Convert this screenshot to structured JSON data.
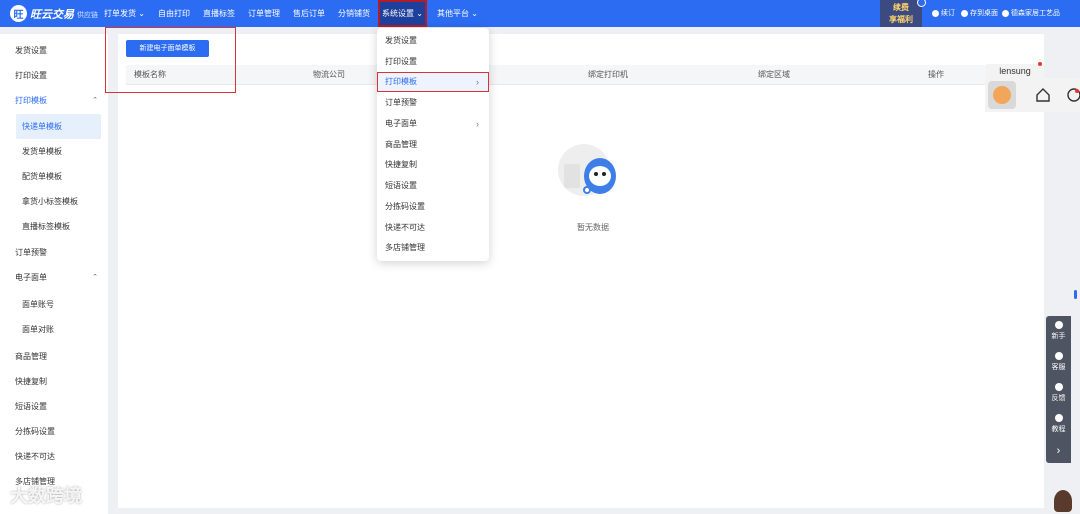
{
  "app": {
    "logo_mark": "旺",
    "logo_text": "旺云交易",
    "logo_sub": "供应链"
  },
  "topnav": [
    {
      "label": "打单发货 ⌄"
    },
    {
      "label": "自由打印"
    },
    {
      "label": "直播标签"
    },
    {
      "label": "订单管理"
    },
    {
      "label": "售后订单"
    },
    {
      "label": "分销铺货"
    },
    {
      "label": "系统设置 ⌄"
    },
    {
      "label": "其他平台 ⌄"
    }
  ],
  "vip": {
    "line1": "续费",
    "line2": "享福利"
  },
  "top_right": {
    "item1": "续订",
    "item2": "存到桌面",
    "item3": "德森家居工艺品"
  },
  "sidebar": {
    "items": [
      {
        "label": "发货设置"
      },
      {
        "label": "打印设置"
      },
      {
        "label": "打印模板",
        "chevron": "⌃"
      },
      {
        "label": "快递单模板"
      },
      {
        "label": "发货单模板"
      },
      {
        "label": "配货单模板"
      },
      {
        "label": "拿货小标签模板"
      },
      {
        "label": "直播标签模板"
      },
      {
        "label": "订单预警"
      },
      {
        "label": "电子面单",
        "chevron": "⌃"
      },
      {
        "label": "面单账号"
      },
      {
        "label": "面单对账"
      },
      {
        "label": "商品管理"
      },
      {
        "label": "快捷复制"
      },
      {
        "label": "短语设置"
      },
      {
        "label": "分拣码设置"
      },
      {
        "label": "快递不可达"
      },
      {
        "label": "多店铺管理"
      }
    ]
  },
  "main": {
    "new_button": "新建电子面单模板",
    "columns": [
      "模板名称",
      "物流公司",
      "",
      "绑定打印机",
      "绑定区域",
      "操作"
    ],
    "empty_text": "暂无数据"
  },
  "dropdown": {
    "items": [
      {
        "label": "发货设置"
      },
      {
        "label": "打印设置"
      },
      {
        "label": "打印模板",
        "arrow": "›"
      },
      {
        "label": "订单预警"
      },
      {
        "label": "电子面单",
        "arrow": "›"
      },
      {
        "label": "商品管理"
      },
      {
        "label": "快捷复制"
      },
      {
        "label": "短语设置"
      },
      {
        "label": "分拣码设置"
      },
      {
        "label": "快递不可达"
      },
      {
        "label": "多店铺管理"
      }
    ]
  },
  "widget": {
    "name": "lensung"
  },
  "float_bar": {
    "items": [
      {
        "label": "新手"
      },
      {
        "label": "客服"
      },
      {
        "label": "反馈"
      },
      {
        "label": "教程"
      },
      {
        "label": "›"
      }
    ]
  },
  "watermark": "大数跨境",
  "colors": {
    "primary": "#2b6cf2",
    "highlight_box": "#d6343b",
    "vip_text": "#ffd36a"
  }
}
